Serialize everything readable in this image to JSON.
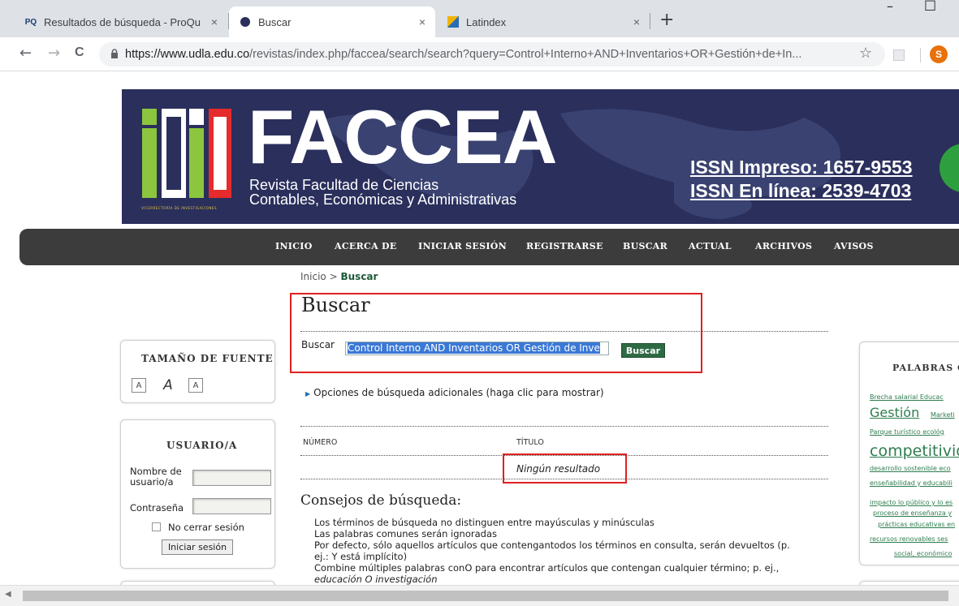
{
  "browser": {
    "tabs": [
      {
        "favicon": "PQ",
        "title": "Resultados de búsqueda - ProQu",
        "close": "×"
      },
      {
        "favicon": "",
        "title": "Buscar",
        "close": "×"
      },
      {
        "favicon": "",
        "title": "Latindex",
        "close": "×"
      }
    ],
    "new_tab": "+",
    "minimize": "–",
    "maximize": "□",
    "back": "←",
    "forward": "→",
    "reload": "C",
    "lock": "🔒",
    "url_host": "https://www.udla.edu.co",
    "url_path": "/revistas/index.php/faccea/search/search?query=Control+Interno+AND+Inventarios+OR+Gestión+de+In...",
    "bookmark_star": "☆",
    "profile_initial": "S"
  },
  "banner": {
    "title": "FACCEA",
    "subtitle_line1": "Revista Facultad de Ciencias",
    "subtitle_line2": "Contables, Económicas y Administrativas",
    "issn_print": "ISSN Impreso: 1657-9553",
    "issn_online": "ISSN En línea:  2539-4703",
    "logo_caption": "VICERRECTORÍA DE INVESTIGACIONES"
  },
  "nav": {
    "items": [
      "INICIO",
      "ACERCA DE",
      "INICIAR SESIÓN",
      "REGISTRARSE",
      "BUSCAR",
      "ACTUAL",
      "ARCHIVOS",
      "AVISOS"
    ]
  },
  "breadcrumb": {
    "home": "Inicio",
    "sep": ">",
    "current": "Buscar"
  },
  "search": {
    "heading": "Buscar",
    "label": "Buscar",
    "query": "Control Interno AND Inventarios OR Gestión de Inve",
    "button": "Buscar",
    "more_options": "Opciones de búsqueda adicionales (haga clic para mostrar)"
  },
  "results": {
    "columns": [
      "NÚMERO",
      "TÍTULO"
    ],
    "empty_message": "Ningún resultado"
  },
  "tips": {
    "heading": "Consejos de búsqueda:",
    "lines": [
      "Los términos de búsqueda no distinguen entre mayúsculas y minúsculas",
      "Las palabras comunes serán ignoradas",
      "Por defecto, sólo aquellos artículos que contengantodos los términos en consulta, serán devueltos (p.",
      "ej.: Y está implícito)",
      "Combine múltiples palabras conO para encontrar artículos que contengan cualquier término; p. ej.,",
      "educación O investigación"
    ]
  },
  "sidebar_left": {
    "font_size_title": "TAMAÑO DE FUENTE",
    "font_buttons": [
      "A",
      "A",
      "A"
    ],
    "user_title": "USUARIO/A",
    "username_label_1": "Nombre de",
    "username_label_2": "usuario/a",
    "password_label": "Contraseña",
    "remember_label": "No cerrar sesión",
    "login_button": "Iniciar sesión"
  },
  "sidebar_right": {
    "title": "PALABRAS C",
    "tags": [
      "Brecha salarial Educac",
      "Gestión",
      "Marketi",
      "Parque turístico ecológ",
      "competitivida",
      "desarrollo sostenible eco",
      "enseñabilidad y educabili",
      "impacto lo público y lo es",
      "proceso de enseñanza y",
      "prácticas educativas en",
      "recursos renovables ses",
      "social, económico"
    ]
  }
}
